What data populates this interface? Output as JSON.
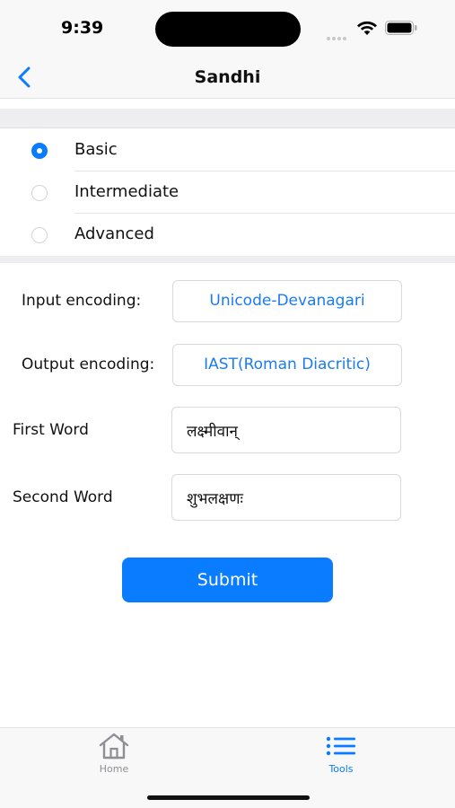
{
  "status_bar": {
    "time": "9:39"
  },
  "nav": {
    "title": "Sandhi"
  },
  "levels": [
    {
      "label": "Basic",
      "selected": true
    },
    {
      "label": "Intermediate",
      "selected": false
    },
    {
      "label": "Advanced",
      "selected": false
    }
  ],
  "form": {
    "input_encoding_label": "Input encoding:",
    "input_encoding_value": "Unicode-Devanagari",
    "output_encoding_label": "Output encoding:",
    "output_encoding_value": "IAST(Roman Diacritic)",
    "first_word_label": "First Word",
    "first_word_value": "लक्ष्मीवान्",
    "second_word_label": "Second Word",
    "second_word_value": "शुभलक्षणः",
    "submit_label": "Submit"
  },
  "tabs": [
    {
      "label": "Home",
      "icon": "home-icon",
      "active": false
    },
    {
      "label": "Tools",
      "icon": "list-icon",
      "active": true
    }
  ],
  "colors": {
    "accent": "#0a7cff",
    "inactive": "#8e8e93"
  }
}
